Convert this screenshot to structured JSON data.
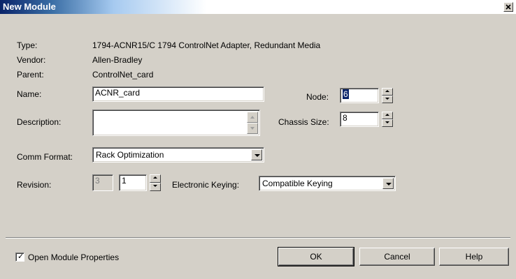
{
  "window": {
    "title": "New Module",
    "close_glyph": "×"
  },
  "info": {
    "type_label": "Type:",
    "type_value": "1794-ACNR15/C 1794 ControlNet Adapter, Redundant Media",
    "vendor_label": "Vendor:",
    "vendor_value": "Allen-Bradley",
    "parent_label": "Parent:",
    "parent_value": "ControlNet_card"
  },
  "form": {
    "name_label": "Name:",
    "name_value": "ACNR_card",
    "description_label": "Description:",
    "description_value": "",
    "node_label": "Node:",
    "node_value": "6",
    "chassis_label": "Chassis Size:",
    "chassis_value": "8",
    "comm_format_label": "Comm Format:",
    "comm_format_value": "Rack Optimization",
    "revision_label": "Revision:",
    "revision_major": "3",
    "revision_minor": "1",
    "keying_label": "Electronic Keying:",
    "keying_value": "Compatible Keying"
  },
  "footer": {
    "open_props_label": "Open Module Properties",
    "open_props_checked": true,
    "ok_label": "OK",
    "cancel_label": "Cancel",
    "help_label": "Help"
  },
  "icons": {
    "close": "close-icon",
    "spin_up": "spin-up-arrow-icon",
    "spin_down": "spin-down-arrow-icon",
    "dropdown": "chevron-down-icon",
    "check": "checkmark-icon"
  },
  "colors": {
    "title_bar": "#0a246a",
    "dialog_face": "#d4d0c8",
    "selection": "#0a246a"
  }
}
